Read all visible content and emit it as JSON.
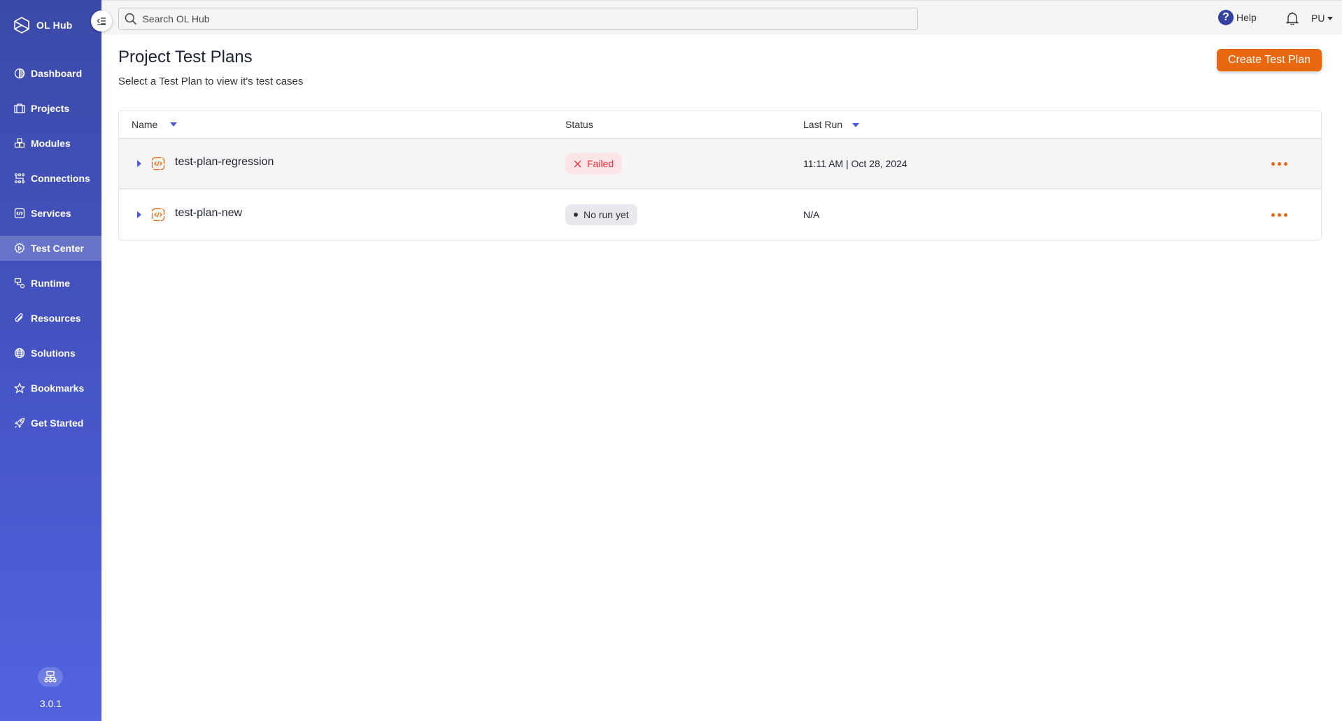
{
  "app": {
    "name": "OL Hub",
    "version": "3.0.1"
  },
  "sidebar": {
    "items": [
      {
        "label": "Dashboard",
        "icon": "dashboard-icon",
        "active": false
      },
      {
        "label": "Projects",
        "icon": "briefcase-icon",
        "active": false
      },
      {
        "label": "Modules",
        "icon": "cubes-icon",
        "active": false
      },
      {
        "label": "Connections",
        "icon": "connections-icon",
        "active": false
      },
      {
        "label": "Services",
        "icon": "code-box-icon",
        "active": false
      },
      {
        "label": "Test Center",
        "icon": "gear-play-icon",
        "active": true
      },
      {
        "label": "Runtime",
        "icon": "runtime-icon",
        "active": false
      },
      {
        "label": "Resources",
        "icon": "paperclip-icon",
        "active": false
      },
      {
        "label": "Solutions",
        "icon": "globe-icon",
        "active": false
      },
      {
        "label": "Bookmarks",
        "icon": "star-icon",
        "active": false
      },
      {
        "label": "Get Started",
        "icon": "rocket-icon",
        "active": false
      }
    ]
  },
  "header": {
    "search_placeholder": "Search OL Hub",
    "help_label": "Help",
    "user_initials": "PU"
  },
  "page": {
    "title": "Project Test Plans",
    "subtitle": "Select a Test Plan to view it's test cases",
    "create_button": "Create Test Plan"
  },
  "table": {
    "columns": {
      "name": "Name",
      "status": "Status",
      "last_run": "Last Run"
    },
    "rows": [
      {
        "name": "test-plan-regression",
        "status": "Failed",
        "status_type": "failed",
        "last_run": "11:11 AM | Oct 28, 2024"
      },
      {
        "name": "test-plan-new",
        "status": "No run yet",
        "status_type": "none",
        "last_run": "N/A"
      }
    ]
  },
  "colors": {
    "accent": "#e8680f",
    "sidebar_top": "#3b4aa8",
    "sidebar_bottom": "#5263e0",
    "failed": "#e0343f",
    "sort_arrow": "#4a5be0"
  }
}
